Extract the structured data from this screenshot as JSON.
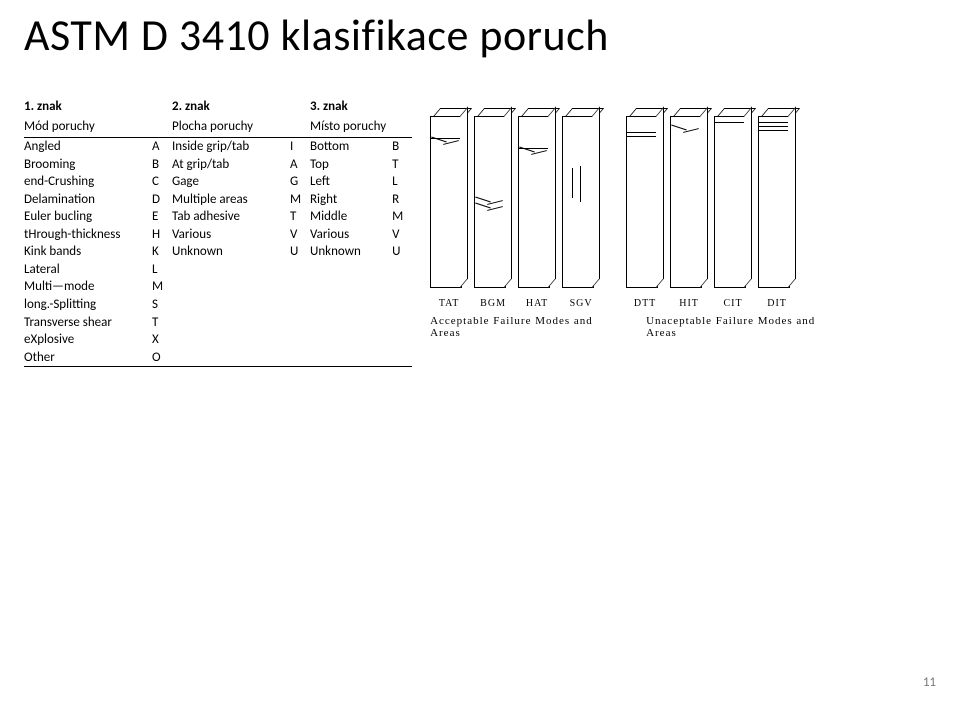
{
  "title": "ASTM D 3410 klasifikace poruch",
  "page_number": "11",
  "columns": {
    "znak1": "1. znak",
    "znak2": "2. znak",
    "znak3": "3. znak",
    "mode": "Mód poruchy",
    "area": "Plocha poruchy",
    "loc": "Místo poruchy"
  },
  "rows": [
    {
      "m": "Angled",
      "mc": "A",
      "a": "Inside grip/tab",
      "ac": "I",
      "l": "Bottom",
      "lc": "B"
    },
    {
      "m": "Brooming",
      "mc": "B",
      "a": "At grip/tab",
      "ac": "A",
      "l": "Top",
      "lc": "T"
    },
    {
      "m": "end-Crushing",
      "mc": "C",
      "a": "Gage",
      "ac": "G",
      "l": "Left",
      "lc": "L"
    },
    {
      "m": "Delamination",
      "mc": "D",
      "a": "Multiple areas",
      "ac": "M",
      "l": "Right",
      "lc": "R"
    },
    {
      "m": "Euler bucling",
      "mc": "E",
      "a": "Tab adhesive",
      "ac": "T",
      "l": "Middle",
      "lc": "M"
    },
    {
      "m": "tHrough-thickness",
      "mc": "H",
      "a": "Various",
      "ac": "V",
      "l": "Various",
      "lc": "V"
    },
    {
      "m": "Kink bands",
      "mc": "K",
      "a": "Unknown",
      "ac": "U",
      "l": "Unknown",
      "lc": "U"
    },
    {
      "m": "Lateral",
      "mc": "L",
      "a": "",
      "ac": "",
      "l": "",
      "lc": ""
    },
    {
      "m": "Multi—mode",
      "mc": "M",
      "a": "",
      "ac": "",
      "l": "",
      "lc": ""
    },
    {
      "m": "long.-Splitting",
      "mc": "S",
      "a": "",
      "ac": "",
      "l": "",
      "lc": ""
    },
    {
      "m": "Transverse shear",
      "mc": "T",
      "a": "",
      "ac": "",
      "l": "",
      "lc": ""
    },
    {
      "m": "eXplosive",
      "mc": "X",
      "a": "",
      "ac": "",
      "l": "",
      "lc": ""
    },
    {
      "m": "Other",
      "mc": "O",
      "a": "",
      "ac": "",
      "l": "",
      "lc": ""
    }
  ],
  "diagram": {
    "labels": [
      "TAT",
      "BGM",
      "HAT",
      "SGV",
      "DTT",
      "HIT",
      "CIT",
      "DIT"
    ],
    "caption_left": "Acceptable   Failure   Modes   and   Areas",
    "caption_right": "Unaceptable   Failure   Modes   and   Areas"
  }
}
